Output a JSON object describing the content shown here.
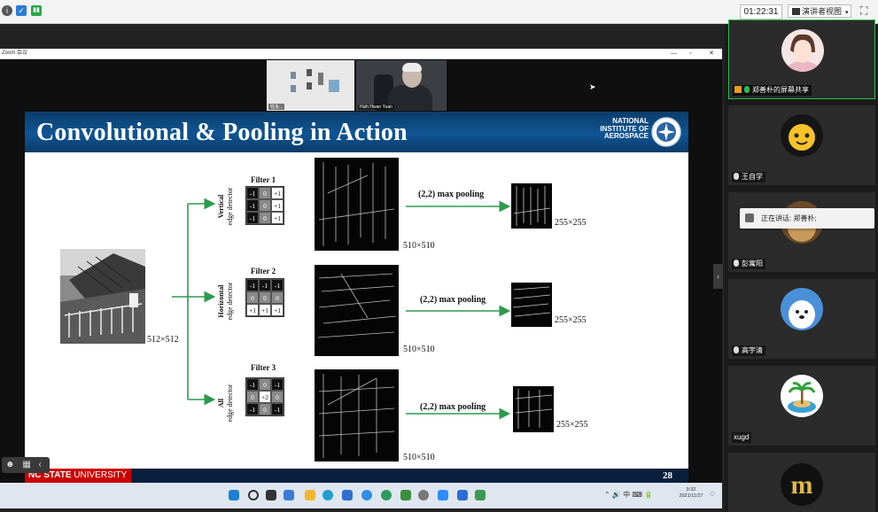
{
  "topbar": {
    "timer": "01:22:31",
    "view_label": "演讲者视图",
    "view_icon": "grid-view-icon",
    "accent": "#2b7cd3"
  },
  "zoom_window": {
    "title": "Zoom 会议"
  },
  "video_thumbs": [
    {
      "label": "任永..."
    },
    {
      "label": "Hsih Hwan Yuan"
    }
  ],
  "slide": {
    "title": "Convolutional & Pooling in Action",
    "org_lines": [
      "NATIONAL",
      "INSTITUTE OF",
      "AEROSPACE"
    ],
    "footer_left_bold": "NC STATE",
    "footer_left": " UNIVERSITY",
    "page": "28",
    "input_size": "512×512",
    "rows": [
      {
        "filter_title": "Filter 1",
        "label_bold": "Vertical",
        "label": "edge detector",
        "kernel": [
          "-1",
          "0",
          "+1",
          "-1",
          "0",
          "+1",
          "-1",
          "0",
          "+1"
        ],
        "conv_size": "510×510",
        "pool_label": "(2,2) max pooling",
        "pool_size": "255×255"
      },
      {
        "filter_title": "Filter 2",
        "label_bold": "Horizontal",
        "label": "edge detector",
        "kernel": [
          "-1",
          "-1",
          "-1",
          "0",
          "0",
          "0",
          "+1",
          "+1",
          "+1"
        ],
        "conv_size": "510×510",
        "pool_label": "(2,2) max pooling",
        "pool_size": "255×255"
      },
      {
        "filter_title": "Filter 3",
        "label_bold": "All",
        "label": "edge detector",
        "kernel": [
          "-1",
          "0",
          "-1",
          "0",
          "+2",
          "0",
          "-1",
          "0",
          "-1"
        ],
        "conv_size": "510×510",
        "pool_label": "(2,2) max pooling",
        "pool_size": "255×255"
      }
    ],
    "colors": {
      "header": "#0f5594",
      "arrow": "#2e9a4e",
      "ncsu_red": "#cc0000"
    }
  },
  "taskbar": {
    "systray": "⌃ 🔊 中 ⌨ 🔋",
    "time": "9:32",
    "date": "2021/11/27"
  },
  "participants": [
    {
      "name": "郑善朴的屏幕共享",
      "active": true
    },
    {
      "name": "王自学",
      "active": false
    },
    {
      "name": "彭寓阳",
      "active": false
    },
    {
      "name": "高宇清",
      "active": false
    },
    {
      "name": "xugd",
      "active": false
    },
    {
      "name": "",
      "active": false
    }
  ],
  "speaking": {
    "text": "正在讲话: 郑善朴;"
  }
}
